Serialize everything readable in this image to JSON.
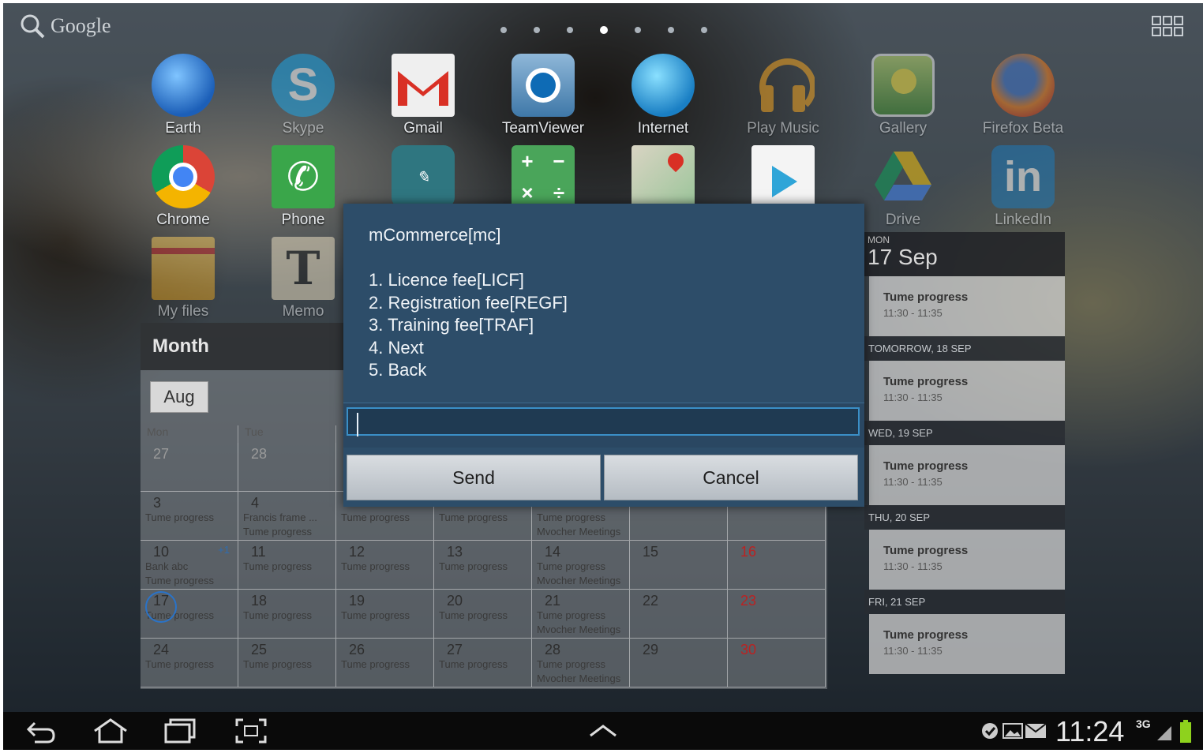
{
  "search": {
    "label": "Google"
  },
  "apps_row1": [
    {
      "label": "Earth",
      "icon": "earth-icon"
    },
    {
      "label": "Skype",
      "icon": "skype-icon"
    },
    {
      "label": "Gmail",
      "icon": "gmail-icon"
    },
    {
      "label": "TeamViewer",
      "icon": "teamviewer-icon"
    },
    {
      "label": "Internet",
      "icon": "globe-icon"
    },
    {
      "label": "Play Music",
      "icon": "headphones-icon"
    },
    {
      "label": "Gallery",
      "icon": "gallery-icon"
    },
    {
      "label": "Firefox Beta",
      "icon": "firefox-icon"
    }
  ],
  "apps_row2": [
    {
      "label": "Chrome",
      "icon": "chrome-icon"
    },
    {
      "label": "Phone",
      "icon": "phone-icon"
    },
    {
      "label": "",
      "icon": "handwriting-icon"
    },
    {
      "label": "",
      "icon": "calculator-icon"
    },
    {
      "label": "",
      "icon": "maps-icon"
    },
    {
      "label": "",
      "icon": "play-store-icon"
    },
    {
      "label": "Drive",
      "icon": "drive-icon"
    },
    {
      "label": "LinkedIn",
      "icon": "linkedin-icon"
    }
  ],
  "apps_row3": [
    {
      "label": "My files",
      "icon": "folder-icon"
    },
    {
      "label": "Memo",
      "icon": "memo-icon"
    }
  ],
  "dialog": {
    "message": "mCommerce[mc]\n\n1. Licence fee[LICF]\n2. Registration fee[REGF]\n3. Training fee[TRAF]\n4. Next\n5. Back",
    "input_value": "",
    "send_label": "Send",
    "cancel_label": "Cancel"
  },
  "month_widget": {
    "title": "Month",
    "month_button": "Aug",
    "day_headers": [
      "Mon",
      "Tue"
    ],
    "weeks": [
      [
        {
          "num": "27",
          "out": true,
          "events": []
        },
        {
          "num": "28",
          "out": true,
          "events": []
        },
        {
          "num": "",
          "events": []
        },
        {
          "num": "",
          "events": []
        },
        {
          "num": "",
          "events": []
        },
        {
          "num": "",
          "events": []
        },
        {
          "num": "",
          "events": []
        }
      ],
      [
        {
          "num": "3",
          "events": [
            "Tume progress"
          ]
        },
        {
          "num": "4",
          "events": [
            "Francis frame ...",
            "Tume progress"
          ]
        },
        {
          "num": "",
          "events": [
            "Tume progress"
          ]
        },
        {
          "num": "",
          "events": [
            "Tume progress"
          ]
        },
        {
          "num": "",
          "events": [
            "Tume progress",
            "Mvocher Meetings"
          ]
        },
        {
          "num": "",
          "events": []
        },
        {
          "num": "",
          "events": []
        }
      ],
      [
        {
          "num": "10",
          "more": "+1",
          "events": [
            "Bank abc",
            "Tume progress"
          ]
        },
        {
          "num": "11",
          "events": [
            "Tume progress"
          ]
        },
        {
          "num": "12",
          "events": [
            "Tume progress"
          ]
        },
        {
          "num": "13",
          "events": [
            "Tume progress"
          ]
        },
        {
          "num": "14",
          "events": [
            "Tume progress",
            "Mvocher Meetings"
          ]
        },
        {
          "num": "15",
          "events": []
        },
        {
          "num": "16",
          "red": true,
          "events": []
        }
      ],
      [
        {
          "num": "17",
          "today": true,
          "events": [
            "Tume progress"
          ]
        },
        {
          "num": "18",
          "events": [
            "Tume progress"
          ]
        },
        {
          "num": "19",
          "events": [
            "Tume progress"
          ]
        },
        {
          "num": "20",
          "events": [
            "Tume progress"
          ]
        },
        {
          "num": "21",
          "events": [
            "Tume progress",
            "Mvocher Meetings"
          ]
        },
        {
          "num": "22",
          "events": []
        },
        {
          "num": "23",
          "red": true,
          "events": []
        }
      ],
      [
        {
          "num": "24",
          "events": [
            "Tume progress"
          ]
        },
        {
          "num": "25",
          "events": [
            "Tume progress"
          ]
        },
        {
          "num": "26",
          "events": [
            "Tume progress"
          ]
        },
        {
          "num": "27",
          "events": [
            "Tume progress"
          ]
        },
        {
          "num": "28",
          "events": [
            "Tume progress",
            "Mvocher Meetings"
          ]
        },
        {
          "num": "29",
          "events": []
        },
        {
          "num": "30",
          "red": true,
          "events": []
        }
      ]
    ]
  },
  "agenda": {
    "day_of_week": "MON",
    "date": "17 Sep",
    "sections": [
      {
        "header": "",
        "title": "Tume progress",
        "time": "11:30 - 11:35"
      },
      {
        "header": "TOMORROW, 18 SEP",
        "title": "Tume progress",
        "time": "11:30 - 11:35"
      },
      {
        "header": "WED, 19 SEP",
        "title": "Tume progress",
        "time": "11:30 - 11:35"
      },
      {
        "header": "THU, 20 SEP",
        "title": "Tume progress",
        "time": "11:30 - 11:35"
      },
      {
        "header": "FRI, 21 SEP",
        "title": "Tume progress",
        "time": "11:30 - 11:35"
      }
    ]
  },
  "status": {
    "time": "11:24",
    "network": "3G"
  },
  "colors": {
    "dialog_bg": "#2d4d69",
    "input_border": "#3a8fc7",
    "weekend": "#b22222",
    "battery": "#8ed21d"
  }
}
